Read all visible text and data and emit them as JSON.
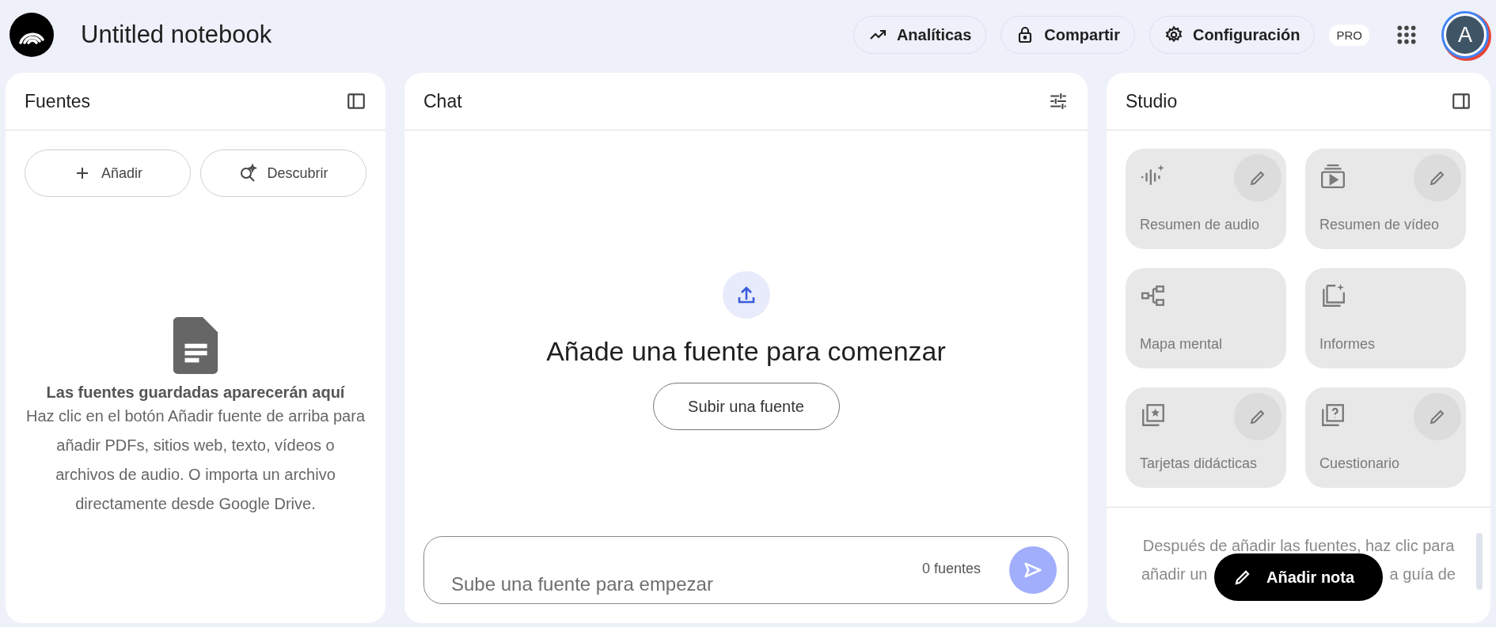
{
  "header": {
    "title": "Untitled notebook",
    "actions": [
      {
        "label": "Analíticas"
      },
      {
        "label": "Compartir"
      },
      {
        "label": "Configuración"
      }
    ],
    "badge": "PRO",
    "avatar": "A"
  },
  "sources": {
    "title": "Fuentes",
    "buttons": [
      {
        "label": "Añadir"
      },
      {
        "label": "Descubrir"
      }
    ],
    "empty_title": "Las fuentes guardadas aparecerán aquí",
    "empty_text": "Haz clic en el botón Añadir fuente de arriba para añadir PDFs, sitios web, texto, vídeos o archivos de audio. O importa un archivo directamente desde Google Drive."
  },
  "chat": {
    "title": "Chat",
    "heading": "Añade una fuente para comenzar",
    "upload_button": "Subir una fuente",
    "input": {
      "placeholder": "Sube una fuente para empezar"
    },
    "source_count": "0 fuentes",
    "send": {
      "disabled": true
    }
  },
  "studio": {
    "title": "Studio",
    "tools": [
      {
        "label": "Resumen de audio",
        "editable": true
      },
      {
        "label": "Resumen de vídeo",
        "editable": true
      },
      {
        "label": "Mapa mental",
        "editable": false
      },
      {
        "label": "Informes",
        "editable": false
      },
      {
        "label": "Tarjetas didácticas",
        "editable": true
      },
      {
        "label": "Cuestionario",
        "editable": true
      }
    ],
    "notes": {
      "line": "Después de añadir las fuentes, haz clic para",
      "line_left": "añadir un",
      "line_right": "a guía de"
    },
    "add_note": "Añadir nota"
  }
}
